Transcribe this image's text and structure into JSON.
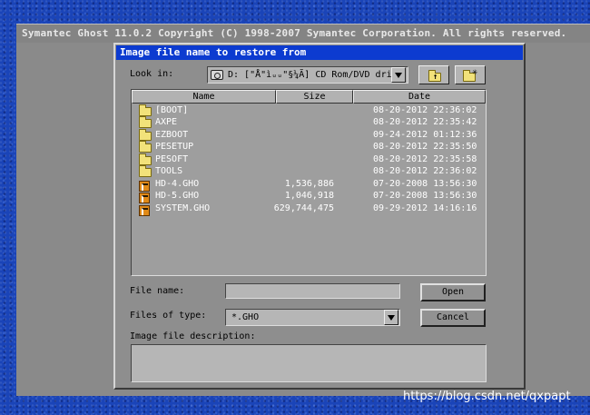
{
  "title_bar": {
    "text": "Symantec Ghost 11.0.2   Copyright (C) 1998-2007 Symantec Corporation. All rights reserved."
  },
  "dialog": {
    "title": "Image file name to restore from",
    "look_in": {
      "label": "Look in:",
      "value": "D: [\"Å\"ìᵤᵤ\"§¼Ã] CD Rom/DVD drive"
    },
    "columns": [
      "Name",
      "Size",
      "Date"
    ],
    "files": [
      {
        "name": "[BOOT]",
        "type": "folder",
        "size": "",
        "date": "08-20-2012 22:36:02"
      },
      {
        "name": "AXPE",
        "type": "folder",
        "size": "",
        "date": "08-20-2012 22:35:42"
      },
      {
        "name": "EZBOOT",
        "type": "folder",
        "size": "",
        "date": "09-24-2012 01:12:36"
      },
      {
        "name": "PESETUP",
        "type": "folder",
        "size": "",
        "date": "08-20-2012 22:35:50"
      },
      {
        "name": "PESOFT",
        "type": "folder",
        "size": "",
        "date": "08-20-2012 22:35:58"
      },
      {
        "name": "TOOLS",
        "type": "folder",
        "size": "",
        "date": "08-20-2012 22:36:02"
      },
      {
        "name": "HD-4.GHO",
        "type": "gho",
        "size": "1,536,886",
        "date": "07-20-2008 13:56:30"
      },
      {
        "name": "HD-5.GHO",
        "type": "gho",
        "size": "1,046,918",
        "date": "07-20-2008 13:56:30"
      },
      {
        "name": "SYSTEM.GHO",
        "type": "gho",
        "size": "629,744,475",
        "date": "09-29-2012 14:16:16"
      }
    ],
    "file_name": {
      "label": "File name:",
      "value": ""
    },
    "files_of_type": {
      "label": "Files of type:",
      "value": "*.GHO"
    },
    "description": {
      "label": "Image file description:",
      "value": ""
    },
    "open_button": "Open",
    "cancel_button": "Cancel"
  },
  "watermark": "https://blog.csdn.net/qxpapt",
  "colors": {
    "title_blue": "#0c3bd0",
    "dialog_gray": "#8e8e8e",
    "desktop_blue": "#1a44b8"
  },
  "icons": {
    "folder": "folder-icon",
    "gho": "ghost-image-icon",
    "drive": "cdrom-drive-icon",
    "up": "up-one-level-icon",
    "new": "new-folder-icon"
  }
}
